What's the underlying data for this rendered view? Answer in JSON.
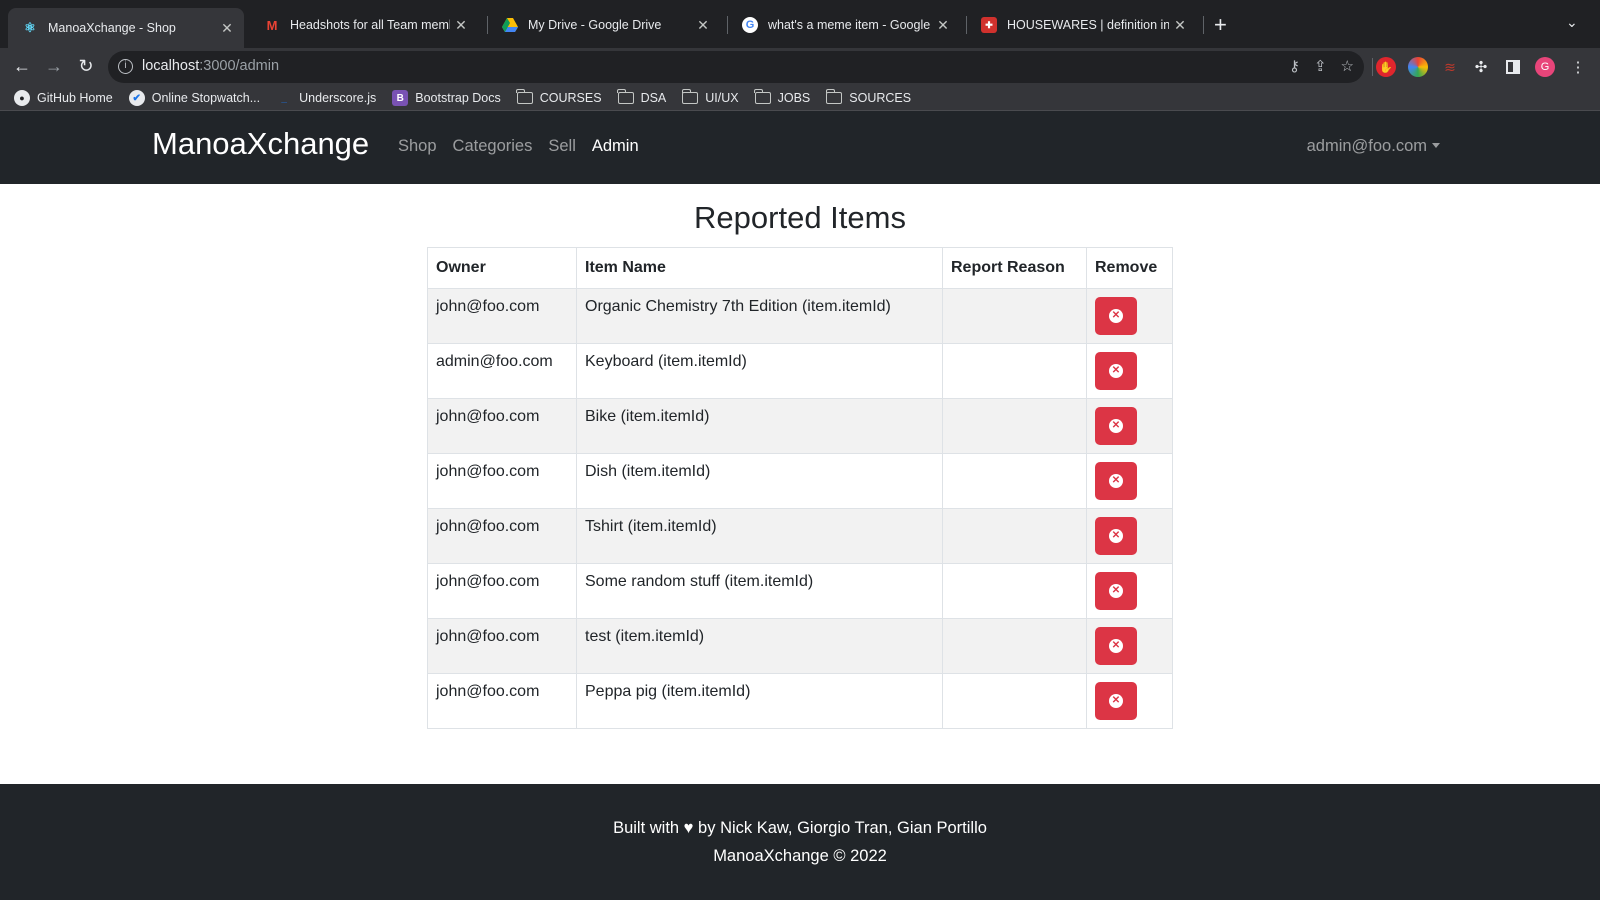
{
  "browser": {
    "tabs": [
      {
        "title": "ManoaXchange - Shop",
        "favicon": "react-icon",
        "active": true
      },
      {
        "title": "Headshots for all Team membe",
        "favicon": "gmail-icon",
        "active": false
      },
      {
        "title": "My Drive - Google Drive",
        "favicon": "google-drive-icon",
        "active": false
      },
      {
        "title": "what's a meme item - Google S",
        "favicon": "google-icon",
        "active": false
      },
      {
        "title": "HOUSEWARES | definition in th",
        "favicon": "cambridge-icon",
        "active": false
      }
    ],
    "url_host": "localhost",
    "url_path": ":3000/admin",
    "profile_initial": "G",
    "bookmarks": [
      {
        "label": "GitHub Home",
        "icon": "github-icon"
      },
      {
        "label": "Online Stopwatch...",
        "icon": "stopwatch-icon"
      },
      {
        "label": "Underscore.js",
        "icon": "underscore-icon"
      },
      {
        "label": "Bootstrap Docs",
        "icon": "bootstrap-icon"
      },
      {
        "label": "COURSES",
        "icon": "folder-icon"
      },
      {
        "label": "DSA",
        "icon": "folder-icon"
      },
      {
        "label": "UI/UX",
        "icon": "folder-icon"
      },
      {
        "label": "JOBS",
        "icon": "folder-icon"
      },
      {
        "label": "SOURCES",
        "icon": "folder-icon"
      }
    ]
  },
  "navbar": {
    "brand": "ManoaXchange",
    "links": [
      {
        "label": "Shop",
        "active": false
      },
      {
        "label": "Categories",
        "active": false
      },
      {
        "label": "Sell",
        "active": false
      },
      {
        "label": "Admin",
        "active": true
      }
    ],
    "user": "admin@foo.com"
  },
  "main": {
    "title": "Reported Items",
    "columns": [
      "Owner",
      "Item Name",
      "Report Reason",
      "Remove"
    ],
    "rows": [
      {
        "owner": "john@foo.com",
        "item": "Organic Chemistry 7th Edition (item.itemId)",
        "reason": ""
      },
      {
        "owner": "admin@foo.com",
        "item": "Keyboard (item.itemId)",
        "reason": ""
      },
      {
        "owner": "john@foo.com",
        "item": "Bike (item.itemId)",
        "reason": ""
      },
      {
        "owner": "john@foo.com",
        "item": "Dish (item.itemId)",
        "reason": ""
      },
      {
        "owner": "john@foo.com",
        "item": "Tshirt (item.itemId)",
        "reason": ""
      },
      {
        "owner": "john@foo.com",
        "item": "Some random stuff (item.itemId)",
        "reason": ""
      },
      {
        "owner": "john@foo.com",
        "item": "test (item.itemId)",
        "reason": ""
      },
      {
        "owner": "john@foo.com",
        "item": "Peppa pig (item.itemId)",
        "reason": ""
      }
    ]
  },
  "footer": {
    "line1": "Built with ♥ by Nick Kaw,  Giorgio Tran,  Gian Portillo",
    "line2": "ManoaXchange © 2022"
  },
  "colors": {
    "navbar_bg": "#212529",
    "danger": "#dc3545",
    "stripe": "#f2f2f2"
  }
}
